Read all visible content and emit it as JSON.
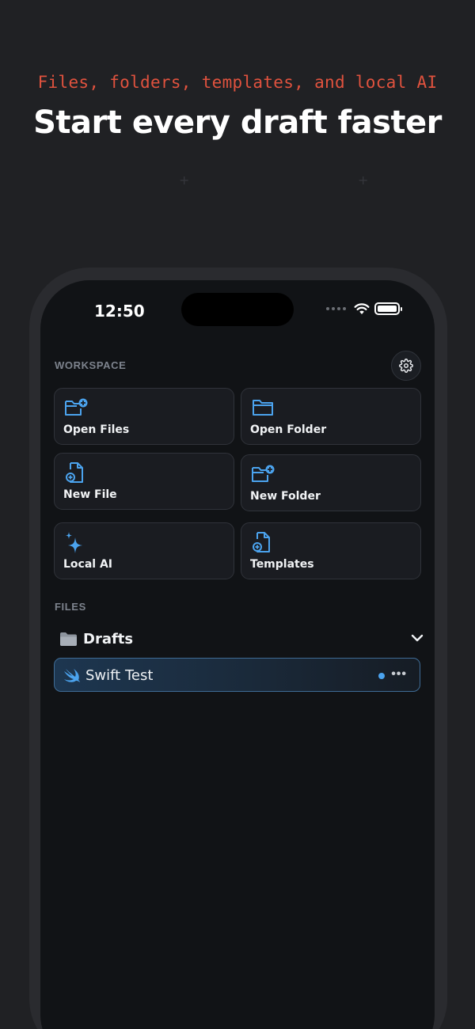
{
  "header": {
    "tagline": "Files, folders, templates, and local AI",
    "headline": "Start every draft faster"
  },
  "status_bar": {
    "time": "12:50"
  },
  "workspace": {
    "label": "WORKSPACE",
    "settings_icon": "gear-icon",
    "tiles": [
      {
        "label": "Open Files",
        "icon": "folder-plus-icon"
      },
      {
        "label": "Open Folder",
        "icon": "folder-icon"
      },
      {
        "label": "New File",
        "icon": "file-plus-icon"
      },
      {
        "label": "New Folder",
        "icon": "folder-plus-icon"
      },
      {
        "label": "Local AI",
        "icon": "sparkles-icon"
      },
      {
        "label": "Templates",
        "icon": "file-plus-icon"
      }
    ]
  },
  "files": {
    "label": "FILES",
    "folder": {
      "name": "Drafts",
      "icon": "folder-icon",
      "expanded": true
    },
    "items": [
      {
        "name": "Swift Test",
        "icon": "swift-icon",
        "unsaved_dot": true,
        "more_label": "•••"
      }
    ]
  },
  "colors": {
    "accent": "#4ba3ee",
    "tagline": "#e0523e",
    "background": "#202124",
    "screen": "#111316"
  }
}
